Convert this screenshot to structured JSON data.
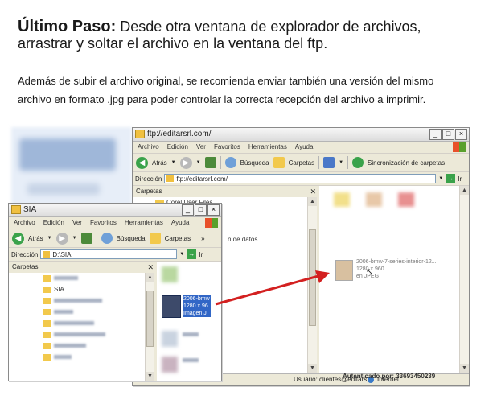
{
  "instructions": {
    "step_bold": "Último Paso:",
    "step_rest": "  Desde otra ventana de explorador de archivos,",
    "step_line2": "arrastrar y soltar el archivo en la ventana del ftp.",
    "para_line1": "Además de subir el archivo original, se recomienda enviar también una versión del mismo",
    "para_line2": "archivo en formato .jpg para poder controlar  la correcta recepción del archivo a imprimir."
  },
  "ftp_window": {
    "title": "ftp://editarsrl.com/",
    "menu": [
      "Archivo",
      "Edición",
      "Ver",
      "Favoritos",
      "Herramientas",
      "Ayuda"
    ],
    "toolbar": {
      "back": "Atrás",
      "search": "Búsqueda",
      "folders": "Carpetas",
      "sync": "Sincronización de carpetas"
    },
    "address_label": "Dirección",
    "address_value": "ftp://editarsrl.com/",
    "go_label": "Ir",
    "pane_title": "Carpetas",
    "tree_item": "Corel User Files",
    "partial_item": "n de datos",
    "dropped_file": {
      "name": "2006-bmw-7-series-interior-12...",
      "dims": "1280 x 960",
      "type": "en JPEG"
    },
    "status_user": "Usuario: clientes@editars",
    "status_zone": "Internet",
    "authenticated": "Autenticado por: 33693450239"
  },
  "sia_window": {
    "title": "SIA",
    "menu": [
      "Archivo",
      "Edición",
      "Ver",
      "Favoritos",
      "Herramientas",
      "Ayuda"
    ],
    "toolbar": {
      "back": "Atrás",
      "search": "Búsqueda",
      "folders": "Carpetas"
    },
    "address_label": "Dirección",
    "address_value": "D:\\SIA",
    "go_label": "Ir",
    "pane_title": "Carpetas",
    "selected_folder": "SIA",
    "file": {
      "name": "2006-bmw",
      "dims": "1280 x 96",
      "type": "Imagen J"
    }
  },
  "colors": {
    "arrow": "#d32020",
    "window_bg": "#ece9d8",
    "go_green": "#3aa24a"
  }
}
